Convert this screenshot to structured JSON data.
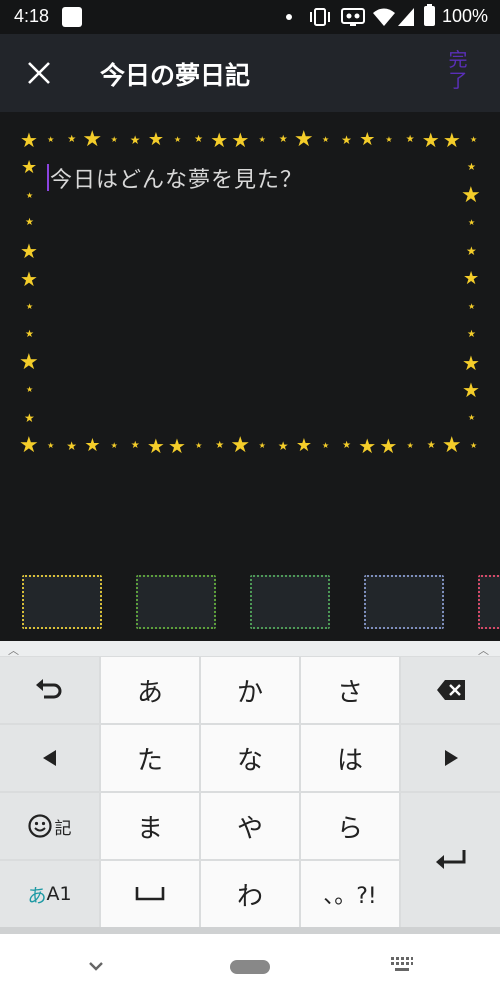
{
  "status_bar": {
    "time": "4:18",
    "battery": "100%",
    "icons": [
      "notification-icon",
      "dot-icon",
      "vibrate-icon",
      "cast-icon",
      "wifi-icon",
      "signal-icon",
      "battery-icon"
    ]
  },
  "app_bar": {
    "title": "今日の夢日記",
    "done_label": "完了",
    "close_icon": "close-icon",
    "done_color": "#5a2fb8"
  },
  "editor": {
    "placeholder": "今日はどんな夢を見た？",
    "frame_style": "stars",
    "star_color": "#f4cd2a",
    "caret_color": "#8b44e0"
  },
  "frame_picker": {
    "items": [
      {
        "style": "yellow-dots",
        "color": "#d9c039"
      },
      {
        "style": "green-dots",
        "color": "#5da03b"
      },
      {
        "style": "green-dots-2",
        "color": "#4e9a57"
      },
      {
        "style": "blue-dots",
        "color": "#7f8fbd"
      },
      {
        "style": "pink-dots",
        "color": "#d64a68"
      }
    ]
  },
  "keyboard": {
    "undo_icon": "undo-icon",
    "delete_icon": "backspace-icon",
    "left_icon": "cursor-left-icon",
    "right_icon": "cursor-right-icon",
    "emoji_label": "記",
    "mode_label_kana": "あ",
    "mode_label_alpha": "A1",
    "enter_icon": "enter-icon",
    "space_icon": "space-icon",
    "keys": {
      "a": "あ",
      "ka": "か",
      "sa": "さ",
      "ta": "た",
      "na": "な",
      "ha": "は",
      "ma": "ま",
      "ya": "や",
      "ra": "ら",
      "wa": "わ",
      "punct": "、。?!"
    }
  },
  "nav_bar": {
    "icons": [
      "back-chevron-icon",
      "home-pill-icon",
      "keyboard-icon"
    ]
  }
}
